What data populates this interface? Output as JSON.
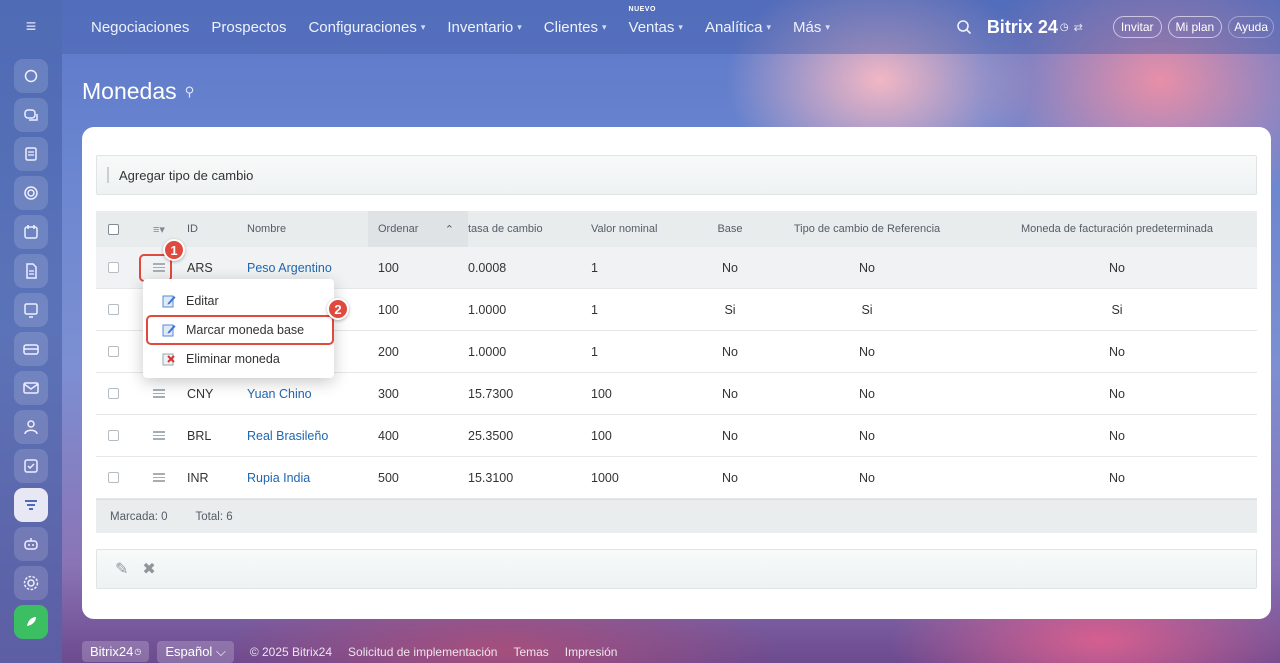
{
  "nav": {
    "items": [
      {
        "label": "Negociaciones",
        "chevron": false
      },
      {
        "label": "Prospectos",
        "chevron": false
      },
      {
        "label": "Configuraciones",
        "chevron": true
      },
      {
        "label": "Inventario",
        "chevron": true
      },
      {
        "label": "Clientes",
        "chevron": true
      },
      {
        "label": "Ventas",
        "chevron": true,
        "badge": "NUEVO"
      },
      {
        "label": "Analítica",
        "chevron": true
      },
      {
        "label": "Más",
        "chevron": true
      }
    ]
  },
  "header": {
    "brand": "Bitrix 24",
    "invite": "Invitar",
    "plan": "Mi plan",
    "help": "Ayuda"
  },
  "page": {
    "title": "Monedas"
  },
  "toolbar": {
    "add_rate": "Agregar tipo de cambio"
  },
  "table": {
    "headers": {
      "id": "ID",
      "name": "Nombre",
      "order": "Ordenar",
      "rate": "tasa de cambio",
      "nominal": "Valor nominal",
      "base": "Base",
      "ref": "Tipo de cambio de Referencia",
      "default": "Moneda de facturación predeterminada"
    },
    "rows": [
      {
        "id": "ARS",
        "name": "Peso Argentino",
        "order": "100",
        "rate": "0.0008",
        "nominal": "1",
        "base": "No",
        "ref": "No",
        "default": "No"
      },
      {
        "id": "",
        "name": "",
        "order": "100",
        "rate": "1.0000",
        "nominal": "1",
        "base": "Si",
        "ref": "Si",
        "default": "Si"
      },
      {
        "id": "",
        "name": "",
        "order": "200",
        "rate": "1.0000",
        "nominal": "1",
        "base": "No",
        "ref": "No",
        "default": "No"
      },
      {
        "id": "CNY",
        "name": "Yuan Chino",
        "order": "300",
        "rate": "15.7300",
        "nominal": "100",
        "base": "No",
        "ref": "No",
        "default": "No"
      },
      {
        "id": "BRL",
        "name": "Real Brasileño",
        "order": "400",
        "rate": "25.3500",
        "nominal": "100",
        "base": "No",
        "ref": "No",
        "default": "No"
      },
      {
        "id": "INR",
        "name": "Rupia India",
        "order": "500",
        "rate": "15.3100",
        "nominal": "1000",
        "base": "No",
        "ref": "No",
        "default": "No"
      }
    ],
    "footer": {
      "marked": "Marcada: 0",
      "total": "Total: 6"
    }
  },
  "context_menu": {
    "items": [
      "Editar",
      "Marcar moneda base",
      "Eliminar moneda"
    ]
  },
  "markers": [
    "1",
    "2"
  ],
  "footer": {
    "brand": "Bitrix24",
    "language": "Español",
    "copyright": "© 2025 Bitrix24",
    "links": [
      "Solicitud de implementación",
      "Temas",
      "Impresión"
    ]
  },
  "colors": {
    "accent_red": "#e04a3e",
    "link_blue": "#2067b0",
    "rail_green": "#3bbf62"
  }
}
